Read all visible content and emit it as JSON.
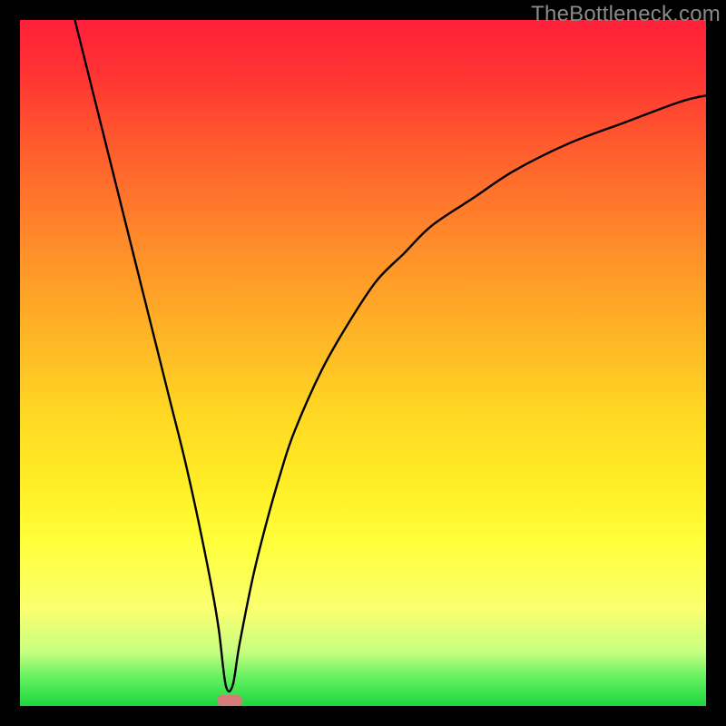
{
  "watermark": "TheBottleneck.com",
  "chart_data": {
    "type": "line",
    "title": "",
    "xlabel": "",
    "ylabel": "",
    "xlim": [
      0,
      100
    ],
    "ylim": [
      0,
      100
    ],
    "grid": false,
    "series": [
      {
        "name": "curve",
        "x": [
          8,
          10,
          12,
          14,
          16,
          18,
          20,
          22,
          24,
          26,
          28,
          29,
          30,
          31,
          32,
          34,
          36,
          38,
          40,
          44,
          48,
          52,
          56,
          60,
          66,
          72,
          80,
          88,
          96,
          100
        ],
        "y": [
          100,
          92,
          84,
          76,
          68,
          60,
          52,
          44,
          36,
          27,
          17,
          11,
          3,
          3,
          9,
          19,
          27,
          34,
          40,
          49,
          56,
          62,
          66,
          70,
          74,
          78,
          82,
          85,
          88,
          89
        ]
      }
    ],
    "vertex_marker": {
      "x": 30.5,
      "y": 0.8,
      "color": "#d77c7c"
    },
    "gradient_colors": {
      "top": "#ff1f3a",
      "mid": "#ffe22a",
      "bottom": "#1dd63f"
    }
  }
}
